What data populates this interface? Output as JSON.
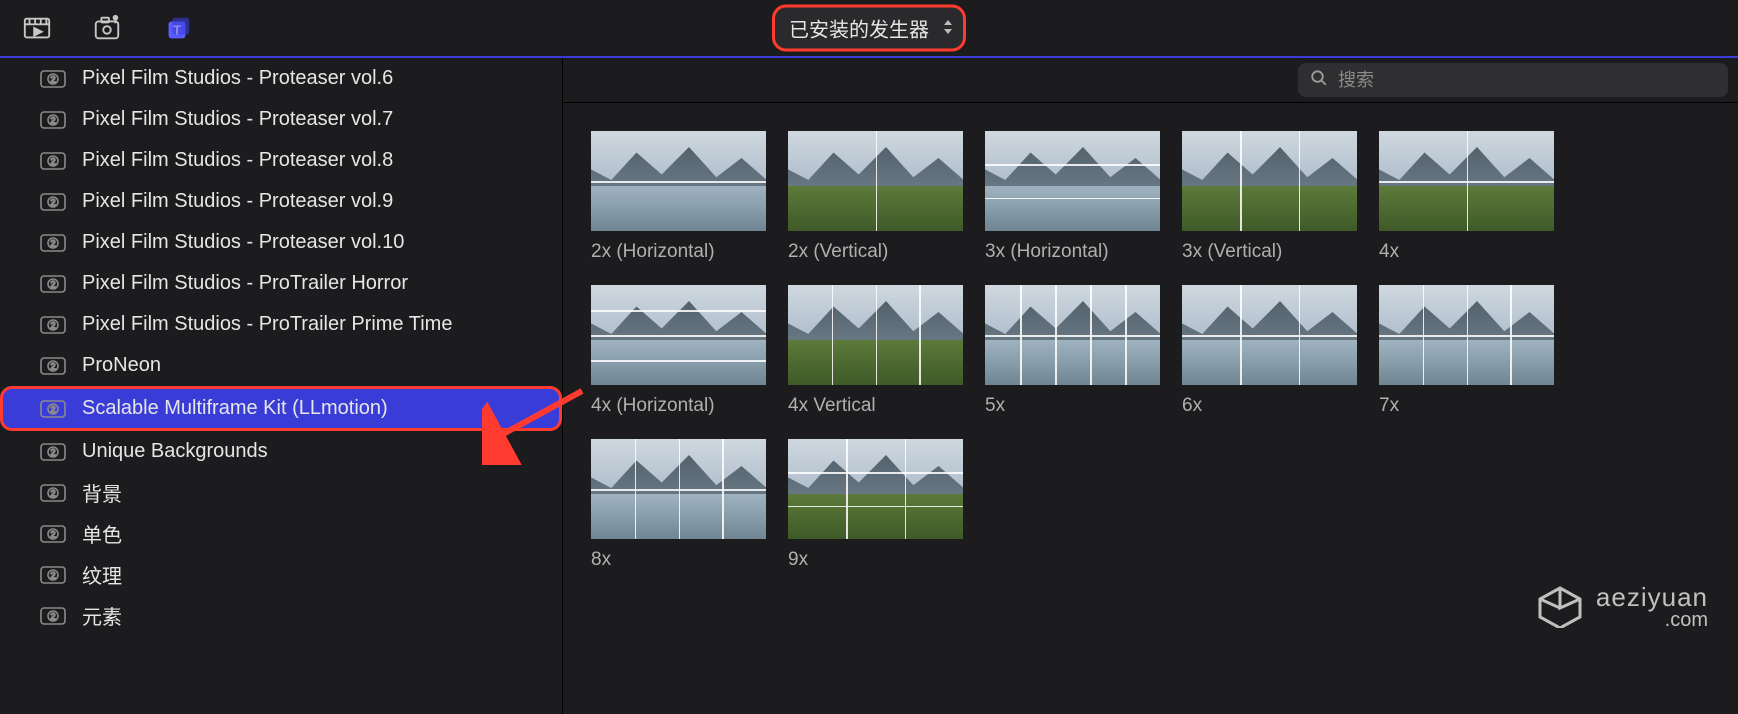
{
  "topbar": {
    "dropdown_label": "已安装的发生器"
  },
  "search": {
    "placeholder": "搜索"
  },
  "sidebar": {
    "items": [
      {
        "label": "Pixel Film Studios - Proteaser vol.6",
        "selected": false
      },
      {
        "label": "Pixel Film Studios - Proteaser vol.7",
        "selected": false
      },
      {
        "label": "Pixel Film Studios - Proteaser vol.8",
        "selected": false
      },
      {
        "label": "Pixel Film Studios - Proteaser vol.9",
        "selected": false
      },
      {
        "label": "Pixel Film Studios - Proteaser vol.10",
        "selected": false
      },
      {
        "label": "Pixel Film Studios - ProTrailer Horror",
        "selected": false
      },
      {
        "label": "Pixel Film Studios - ProTrailer Prime Time",
        "selected": false
      },
      {
        "label": "ProNeon",
        "selected": false
      },
      {
        "label": "Scalable Multiframe Kit (LLmotion)",
        "selected": true
      },
      {
        "label": "Unique Backgrounds",
        "selected": false
      },
      {
        "label": "背景",
        "selected": false
      },
      {
        "label": "单色",
        "selected": false
      },
      {
        "label": "纹理",
        "selected": false
      },
      {
        "label": "元素",
        "selected": false
      }
    ]
  },
  "thumbnails": [
    {
      "label": "2x (Horizontal)",
      "cols": 1,
      "rows": 2,
      "land": "water"
    },
    {
      "label": "2x (Vertical)",
      "cols": 2,
      "rows": 1,
      "land": "grass"
    },
    {
      "label": "3x (Horizontal)",
      "cols": 1,
      "rows": 3,
      "land": "water"
    },
    {
      "label": "3x (Vertical)",
      "cols": 3,
      "rows": 1,
      "land": "grass"
    },
    {
      "label": "4x",
      "cols": 2,
      "rows": 2,
      "land": "grass"
    },
    {
      "label": "4x (Horizontal)",
      "cols": 1,
      "rows": 4,
      "land": "water"
    },
    {
      "label": "4x Vertical",
      "cols": 4,
      "rows": 1,
      "land": "grass"
    },
    {
      "label": "5x",
      "cols": 5,
      "rows": 2,
      "land": "water"
    },
    {
      "label": "6x",
      "cols": 3,
      "rows": 2,
      "land": "water"
    },
    {
      "label": "7x",
      "cols": 4,
      "rows": 2,
      "land": "water"
    },
    {
      "label": "8x",
      "cols": 4,
      "rows": 2,
      "land": "water"
    },
    {
      "label": "9x",
      "cols": 3,
      "rows": 3,
      "land": "grass"
    }
  ],
  "watermark": {
    "line1": "aeziyuan",
    "line2": ".com"
  }
}
